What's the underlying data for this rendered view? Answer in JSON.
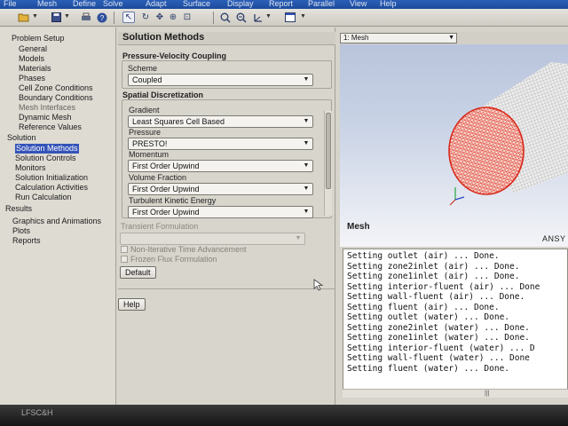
{
  "menu": [
    "File",
    "Mesh",
    "Define",
    "Solve",
    "Adapt",
    "Surface",
    "Display",
    "Report",
    "Parallel",
    "View",
    "Help"
  ],
  "toolbar": {
    "icons": [
      "open-folder-icon",
      "dropdown-arrow-icon",
      "save-icon",
      "dropdown-arrow-icon",
      "print-icon",
      "help-icon",
      "pointer-icon",
      "rotate-icon",
      "translate-icon",
      "zoom-in-icon",
      "zoom-box-icon",
      "axes-view-icon",
      "layout-icon",
      "dropdown-arrow-icon"
    ]
  },
  "tree": {
    "problem_setup": "Problem Setup",
    "general": "General",
    "models": "Models",
    "materials": "Materials",
    "phases": "Phases",
    "cell_zone_conditions": "Cell Zone Conditions",
    "boundary_conditions": "Boundary Conditions",
    "mesh_interfaces": "Mesh Interfaces",
    "dynamic_mesh": "Dynamic Mesh",
    "reference_values": "Reference Values",
    "solution": "Solution",
    "solution_methods": "Solution Methods",
    "solution_controls": "Solution Controls",
    "monitors": "Monitors",
    "solution_initialization": "Solution Initialization",
    "calculation_activities": "Calculation Activities",
    "run_calculation": "Run Calculation",
    "results": "Results",
    "graphics_and_animations": "Graphics and Animations",
    "plots": "Plots",
    "reports": "Reports"
  },
  "panel": {
    "title": "Solution Methods",
    "pv_coupling": "Pressure-Velocity Coupling",
    "scheme_label": "Scheme",
    "scheme_value": "Coupled",
    "spatial_discretization": "Spatial Discretization",
    "gradient_label": "Gradient",
    "gradient_value": "Least Squares Cell Based",
    "pressure_label": "Pressure",
    "pressure_value": "PRESTO!",
    "momentum_label": "Momentum",
    "momentum_value": "First Order Upwind",
    "volume_fraction_label": "Volume Fraction",
    "volume_fraction_value": "First Order Upwind",
    "tke_label": "Turbulent Kinetic Energy",
    "tke_value": "First Order Upwind",
    "transient_formulation": "Transient Formulation",
    "transient_value": "",
    "non_iterative": "Non-Iterative Time Advancement",
    "frozen_flux": "Frozen Flux Formulation",
    "default_button": "Default",
    "help_button": "Help"
  },
  "graphics": {
    "window_select": "1: Mesh",
    "caption": "Mesh",
    "brand": "ANSY",
    "mesh_colors": {
      "inlet_face": "#e8311c",
      "body": "#c9c9c9"
    }
  },
  "console": {
    "lines": [
      "Setting outlet (air) ... Done.",
      "Setting zone2inlet (air) ... Done.",
      "Setting zone1inlet (air) ... Done.",
      "Setting interior-fluent (air) ... Done",
      "Setting wall-fluent (air) ... Done.",
      "Setting fluent (air) ... Done.",
      "Setting outlet (water) ... Done.",
      "Setting zone2inlet (water) ... Done.",
      "Setting zone1inlet (water) ... Done.",
      "Setting interior-fluent (water) ... D",
      "Setting wall-fluent (water) ... Done",
      "Setting fluent (water) ... Done."
    ]
  },
  "taskbar": {
    "text": "LFSC&H"
  }
}
